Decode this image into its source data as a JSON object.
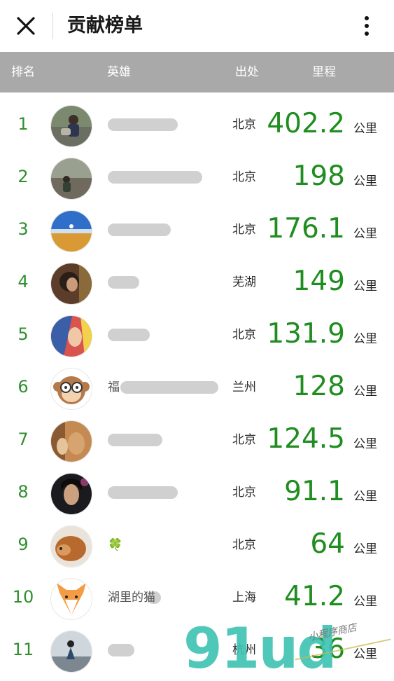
{
  "topbar": {
    "title": "贡献榜单",
    "close_icon": "close-icon",
    "more_icon": "more-vertical-icon"
  },
  "header": {
    "rank": "排名",
    "hero": "英雄",
    "origin": "出处",
    "distance": "里程"
  },
  "colors": {
    "header_bg": "#a9a9a9",
    "rank_green": "#2f8f2f",
    "distance_green": "#1f8d1f",
    "watermark": "#3cc3b2"
  },
  "rows": [
    {
      "rank": "1",
      "name": "",
      "city": "北京",
      "distance": "402.2",
      "unit": "公里"
    },
    {
      "rank": "2",
      "name": "",
      "city": "北京",
      "distance": "198",
      "unit": "公里"
    },
    {
      "rank": "3",
      "name": "",
      "city": "北京",
      "distance": "176.1",
      "unit": "公里"
    },
    {
      "rank": "4",
      "name": "",
      "city": "芜湖",
      "distance": "149",
      "unit": "公里"
    },
    {
      "rank": "5",
      "name": "",
      "city": "北京",
      "distance": "131.9",
      "unit": "公里"
    },
    {
      "rank": "6",
      "name": "福",
      "city": "兰州",
      "distance": "128",
      "unit": "公里"
    },
    {
      "rank": "7",
      "name": "",
      "city": "北京",
      "distance": "124.5",
      "unit": "公里"
    },
    {
      "rank": "8",
      "name": "",
      "city": "北京",
      "distance": "91.1",
      "unit": "公里"
    },
    {
      "rank": "9",
      "name": "🍀",
      "city": "北京",
      "distance": "64",
      "unit": "公里"
    },
    {
      "rank": "10",
      "name": "湖里的猫",
      "city": "上海",
      "distance": "41.2",
      "unit": "公里"
    },
    {
      "rank": "11",
      "name": "",
      "city": "杭州",
      "distance": "36",
      "unit": "公里"
    }
  ],
  "watermark": {
    "logo": "91ud",
    "text": "小程序商店"
  }
}
